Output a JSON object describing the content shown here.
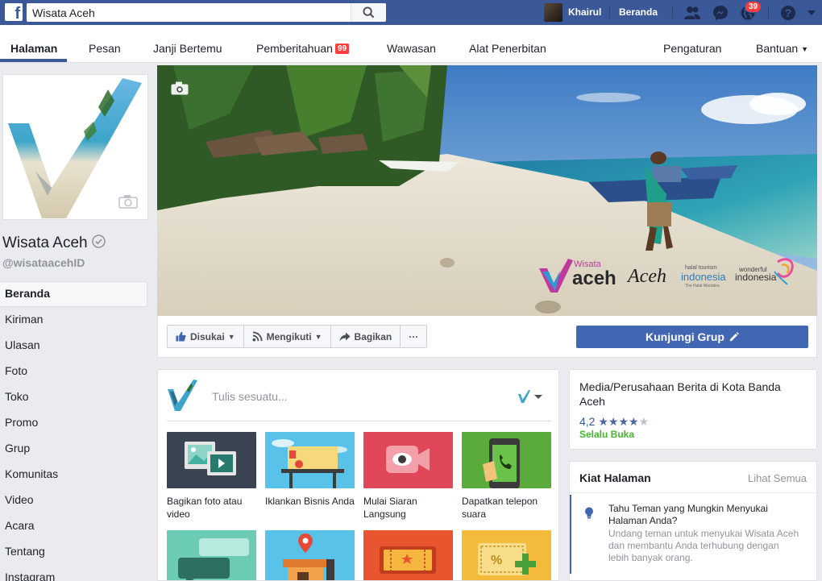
{
  "topbar": {
    "search_value": "Wisata Aceh",
    "user_name": "Khairul",
    "home_label": "Beranda",
    "notification_count": "39",
    "colors": {
      "bar": "#3b5998",
      "badge": "#fa3e3e"
    }
  },
  "page_nav": {
    "items": [
      {
        "label": "Halaman"
      },
      {
        "label": "Pesan"
      },
      {
        "label": "Janji Bertemu"
      },
      {
        "label": "Pemberitahuan",
        "badge": "99"
      },
      {
        "label": "Wawasan"
      },
      {
        "label": "Alat Penerbitan"
      },
      {
        "label": "Pengaturan"
      },
      {
        "label": "Bantuan"
      }
    ]
  },
  "page": {
    "name": "Wisata Aceh",
    "handle": "@wisataacehID"
  },
  "left_nav": {
    "items": [
      {
        "label": "Beranda"
      },
      {
        "label": "Kiriman"
      },
      {
        "label": "Ulasan"
      },
      {
        "label": "Foto"
      },
      {
        "label": "Toko"
      },
      {
        "label": "Promo"
      },
      {
        "label": "Grup"
      },
      {
        "label": "Komunitas"
      },
      {
        "label": "Video"
      },
      {
        "label": "Acara"
      },
      {
        "label": "Tentang"
      },
      {
        "label": "Instagram"
      }
    ]
  },
  "actions": {
    "like_label": "Disukai",
    "follow_label": "Mengikuti",
    "share_label": "Bagikan",
    "more_label": "···",
    "visit_group_label": "Kunjungi Grup"
  },
  "cover_logos": {
    "brand_top": "Wisata",
    "brand_main": "aceh",
    "brand_script": "Aceh",
    "halal_small": "halal tourism",
    "indo1": "indonesia",
    "indo1_sub": "The Halal Wonders",
    "wonderful_small": "wonderful",
    "indo2": "indonesia"
  },
  "composer": {
    "placeholder": "Tulis sesuatu...",
    "tiles": [
      {
        "label": "Bagikan foto atau video"
      },
      {
        "label": "Iklankan Bisnis Anda"
      },
      {
        "label": "Mulai Siaran Langsung"
      },
      {
        "label": "Dapatkan telepon suara"
      },
      {
        "label": ""
      },
      {
        "label": ""
      },
      {
        "label": ""
      },
      {
        "label": ""
      }
    ]
  },
  "info": {
    "category": "Media/Perusahaan Berita di Kota Banda Aceh",
    "rating": "4,2",
    "rating_value": 4.2,
    "rating_max": 5,
    "stars_full": "★★★★",
    "stars_empty": "★",
    "open_status": "Selalu Buka"
  },
  "tips": {
    "title": "Kiat Halaman",
    "see_all": "Lihat Semua",
    "tip_title": "Tahu Teman yang Mungkin Menyukai Halaman Anda?",
    "tip_desc": "Undang teman untuk menyukai Wisata Aceh dan membantu Anda terhubung dengan lebih banyak orang."
  }
}
